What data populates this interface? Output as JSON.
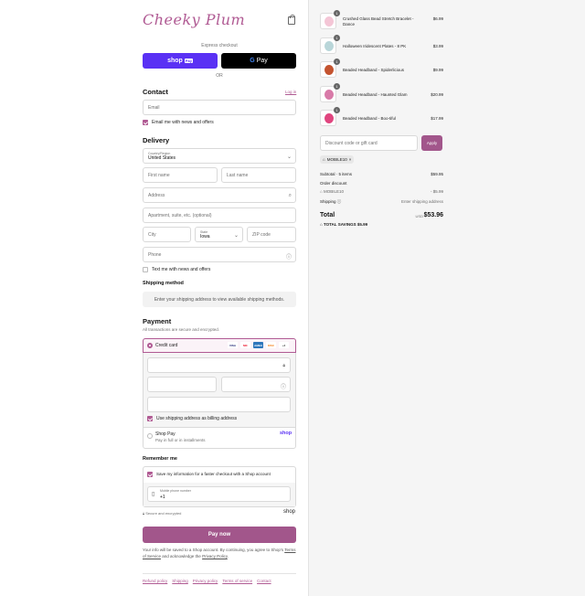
{
  "brand": {
    "logo_text": "Cheeky Plum",
    "accent": "#a2568b",
    "link_color": "#b05a93"
  },
  "express": {
    "label": "Express checkout",
    "shop_pay": "shop",
    "shop_pay_badge": "Pay",
    "gpay_g": "G",
    "gpay": "Pay",
    "or": "OR"
  },
  "contact": {
    "title": "Contact",
    "login": "Log in",
    "email_placeholder": "Email",
    "news_label": "Email me with news and offers"
  },
  "delivery": {
    "title": "Delivery",
    "country_label": "Country/Region",
    "country_value": "United States",
    "first_name": "First name",
    "last_name": "Last name",
    "address": "Address",
    "apartment": "Apartment, suite, etc. (optional)",
    "city": "City",
    "state_label": "State",
    "state_value": "Iowa",
    "zip": "ZIP code",
    "phone": "Phone",
    "text_label": "Text me with news and offers"
  },
  "shipping": {
    "title": "Shipping method",
    "message": "Enter your shipping address to view available shipping methods."
  },
  "payment": {
    "title": "Payment",
    "subtitle": "All transactions are secure and encrypted.",
    "credit_card": "Credit card",
    "cards": [
      "VISA",
      "MC",
      "AMEX",
      "DISC"
    ],
    "more": "+3",
    "billing_label": "Use shipping address as billing address",
    "shop_pay_title": "Shop Pay",
    "shop_pay_sub": "Pay in full or in installments",
    "shop_logo": "shop"
  },
  "remember": {
    "title": "Remember me",
    "save_label": "Save my information for a faster checkout with a Shop account",
    "phone_label": "Mobile phone number",
    "phone_prefix": "+1",
    "secure": "Secure and encrypted",
    "shop_logo": "shop"
  },
  "pay_now": "Pay now",
  "legal": {
    "text1": "Your info will be saved to a Shop account. By continuing, you agree to Shop's",
    "terms": "Terms of Service",
    "text2": "and acknowledge the",
    "privacy": "Privacy Policy",
    "end": "."
  },
  "footer_links": [
    "Refund policy",
    "Shipping",
    "Privacy policy",
    "Terms of service",
    "Contact"
  ],
  "cart": {
    "items": [
      {
        "name": "Crushed Glass Bead Stretch Bracelet - Dance",
        "qty": "1",
        "price": "$6.99",
        "color": "#f4c6d6"
      },
      {
        "name": "Halloween Iridescent Plates - 8 PK",
        "qty": "1",
        "price": "$3.99",
        "color": "#b9d6d9"
      },
      {
        "name": "Beaded Headband - Spiderlicious",
        "qty": "1",
        "price": "$9.99",
        "color": "#c4532f"
      },
      {
        "name": "Beaded Headband - Haunted Glam",
        "qty": "1",
        "price": "$20.99",
        "color": "#d87aa8"
      },
      {
        "name": "Beaded Headband - Boo-tiful",
        "qty": "1",
        "price": "$17.99",
        "color": "#e0457f"
      }
    ],
    "discount_placeholder": "Discount code or gift card",
    "apply": "Apply",
    "code": "MOBILE10",
    "subtotal_label": "Subtotal · 5 items",
    "subtotal": "$59.95",
    "order_discount": "Order discount",
    "discount_code": "MOBILE10",
    "discount_amount": "- $5.99",
    "shipping_label": "Shipping",
    "shipping_value": "Enter shipping address",
    "total_label": "Total",
    "currency": "USD",
    "total": "$53.96",
    "savings_label": "TOTAL SAVINGS",
    "savings": "$5.99"
  }
}
